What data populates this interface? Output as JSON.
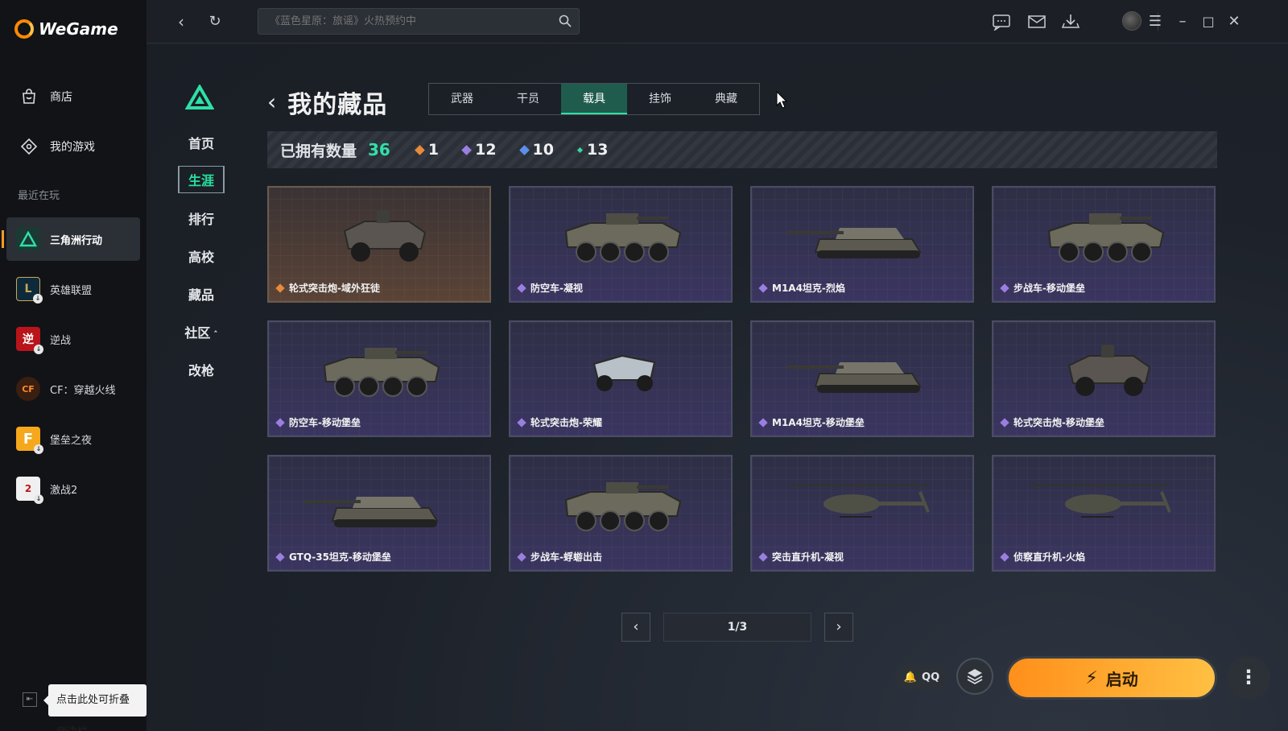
{
  "app": {
    "logo_text": "WeGame"
  },
  "sidebar": {
    "nav": [
      {
        "label": "商店",
        "icon": "store-bag-icon"
      },
      {
        "label": "我的游戏",
        "icon": "game-controller-icon"
      }
    ],
    "recent_label": "最近在玩",
    "games": [
      {
        "label": "三角洲行动",
        "icon": "delta-force-icon",
        "active": true
      },
      {
        "label": "英雄联盟",
        "icon": "league-of-legends-icon",
        "download": true
      },
      {
        "label": "逆战",
        "icon": "nizhan-icon",
        "download": true
      },
      {
        "label": "CF：穿越火线",
        "icon": "crossfire-icon"
      },
      {
        "label": "堡垒之夜",
        "icon": "fortnite-icon",
        "download": true
      },
      {
        "label": "激战2",
        "icon": "guild-wars-2-icon",
        "download": true
      }
    ],
    "collapse_tooltip": "点击此处可折叠侧边栏"
  },
  "topbar": {
    "search_placeholder": "《蓝色星原：旅谣》火热预约中"
  },
  "game_menu": {
    "items": [
      "首页",
      "生涯",
      "排行",
      "高校",
      "藏品",
      "社区",
      "改枪"
    ],
    "active_index": 1
  },
  "page": {
    "title": "我的藏品",
    "tabs": [
      "武器",
      "干员",
      "载具",
      "挂饰",
      "典藏"
    ],
    "active_tab": 2
  },
  "stats": {
    "label": "已拥有数量",
    "total": "36",
    "counts": [
      {
        "value": "1",
        "color": "#e8893c"
      },
      {
        "value": "12",
        "color": "#9b7ee0"
      },
      {
        "value": "10",
        "color": "#5b8fe8"
      },
      {
        "value": "13",
        "color": "#3ad7a0"
      }
    ]
  },
  "vehicles": [
    {
      "name": "轮式突击炮-域外狂徒",
      "rarity": "gold",
      "kind": "wheeled4"
    },
    {
      "name": "防空车-凝视",
      "rarity": "purple",
      "kind": "wheeled8"
    },
    {
      "name": "M1A4坦克-烈焰",
      "rarity": "purple",
      "kind": "tank"
    },
    {
      "name": "步战车-移动堡垒",
      "rarity": "purple",
      "kind": "wheeled8"
    },
    {
      "name": "防空车-移动堡垒",
      "rarity": "purple",
      "kind": "wheeled8"
    },
    {
      "name": "轮式突击炮-荣耀",
      "rarity": "purple",
      "kind": "buggy"
    },
    {
      "name": "M1A4坦克-移动堡垒",
      "rarity": "purple",
      "kind": "tank"
    },
    {
      "name": "轮式突击炮-移动堡垒",
      "rarity": "purple",
      "kind": "wheeled4"
    },
    {
      "name": "GTQ-35坦克-移动堡垒",
      "rarity": "purple",
      "kind": "tank"
    },
    {
      "name": "步战车-蜉蝣出击",
      "rarity": "purple",
      "kind": "wheeled8"
    },
    {
      "name": "突击直升机-凝视",
      "rarity": "purple",
      "kind": "heli"
    },
    {
      "name": "侦察直升机-火焰",
      "rarity": "purple",
      "kind": "heli"
    }
  ],
  "pager": {
    "indicator": "1/3"
  },
  "launch": {
    "qq_label": "QQ",
    "button_label": "启动"
  },
  "colors": {
    "accent": "#32e0a8",
    "launch": "#ffa52a",
    "gold_rarity": "#e8893c",
    "purple_rarity": "#9b7ee0"
  }
}
